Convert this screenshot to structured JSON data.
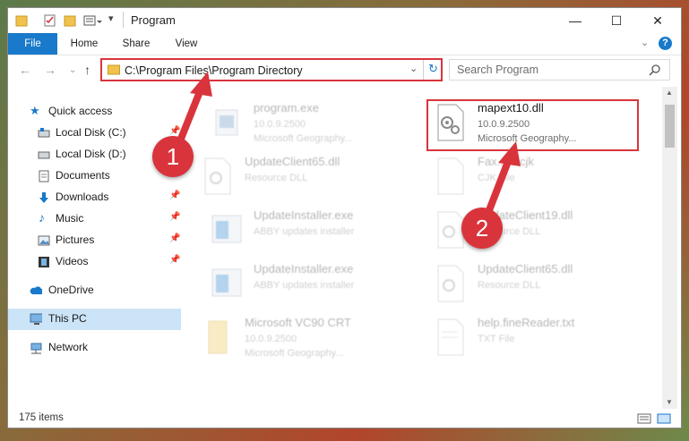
{
  "window": {
    "title": "Program"
  },
  "ribbon": {
    "tabs": [
      "File",
      "Home",
      "Share",
      "View"
    ]
  },
  "address": {
    "path": "C:\\Program Files\\Program Directory"
  },
  "search": {
    "placeholder": "Search Program"
  },
  "sidebar": {
    "items": [
      {
        "label": "Quick access",
        "icon": "star-icon",
        "pinned": false
      },
      {
        "label": "Local Disk (C:)",
        "icon": "drive-icon",
        "pinned": true
      },
      {
        "label": "Local Disk (D:)",
        "icon": "drive-icon",
        "pinned": false
      },
      {
        "label": "Documents",
        "icon": "documents-icon",
        "pinned": false
      },
      {
        "label": "Downloads",
        "icon": "download-icon",
        "pinned": true
      },
      {
        "label": "Music",
        "icon": "music-icon",
        "pinned": true
      },
      {
        "label": "Pictures",
        "icon": "pictures-icon",
        "pinned": true
      },
      {
        "label": "Videos",
        "icon": "video-icon",
        "pinned": true
      },
      {
        "label": "OneDrive",
        "icon": "cloud-icon",
        "pinned": false
      },
      {
        "label": "This PC",
        "icon": "computer-icon",
        "pinned": false,
        "selected": true
      },
      {
        "label": "Network",
        "icon": "network-icon",
        "pinned": false
      }
    ]
  },
  "files": [
    {
      "name": "program.exe",
      "line2": "10.0.9.2500",
      "line3": "Microsoft Geography...",
      "faded": true
    },
    {
      "name": "mapext10.dll",
      "line2": "10.0.9.2500",
      "line3": "Microsoft Geography...",
      "faded": false,
      "highlighted": true
    },
    {
      "name": "UpdateClient65.dll",
      "line2": "Resource DLL",
      "line3": "",
      "faded": true
    },
    {
      "name": "Fax...rs.cjk",
      "line2": "CJK File",
      "line3": "",
      "faded": true
    },
    {
      "name": "UpdateInstaller.exe",
      "line2": "ABBY updates installer",
      "line3": "",
      "faded": true
    },
    {
      "name": "UpdateClient19.dll",
      "line2": "Resource DLL",
      "line3": "",
      "faded": true
    },
    {
      "name": "UpdateInstaller.exe",
      "line2": "ABBY updates installer",
      "line3": "",
      "faded": true
    },
    {
      "name": "UpdateClient65.dll",
      "line2": "Resource DLL",
      "line3": "",
      "faded": true
    },
    {
      "name": "Microsoft VC90 CRT",
      "line2": "10.0.9.2500",
      "line3": "Microsoft Geography...",
      "faded": true
    },
    {
      "name": "help.fineReader.txt",
      "line2": "TXT File",
      "line3": "",
      "faded": true
    }
  ],
  "status": {
    "count": "175 items"
  },
  "callouts": [
    "1",
    "2"
  ],
  "colors": {
    "accent": "#1979ca",
    "highlight": "#d9343c",
    "selected": "#cce4f7"
  }
}
